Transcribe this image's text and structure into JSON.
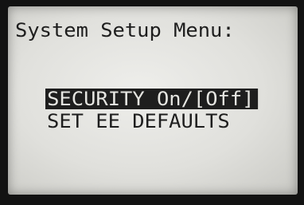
{
  "menu": {
    "title": "System Setup Menu:",
    "items": [
      {
        "label": "SECURITY On/[Off]",
        "selected": true
      },
      {
        "label": "SET EE DEFAULTS",
        "selected": false
      }
    ]
  }
}
